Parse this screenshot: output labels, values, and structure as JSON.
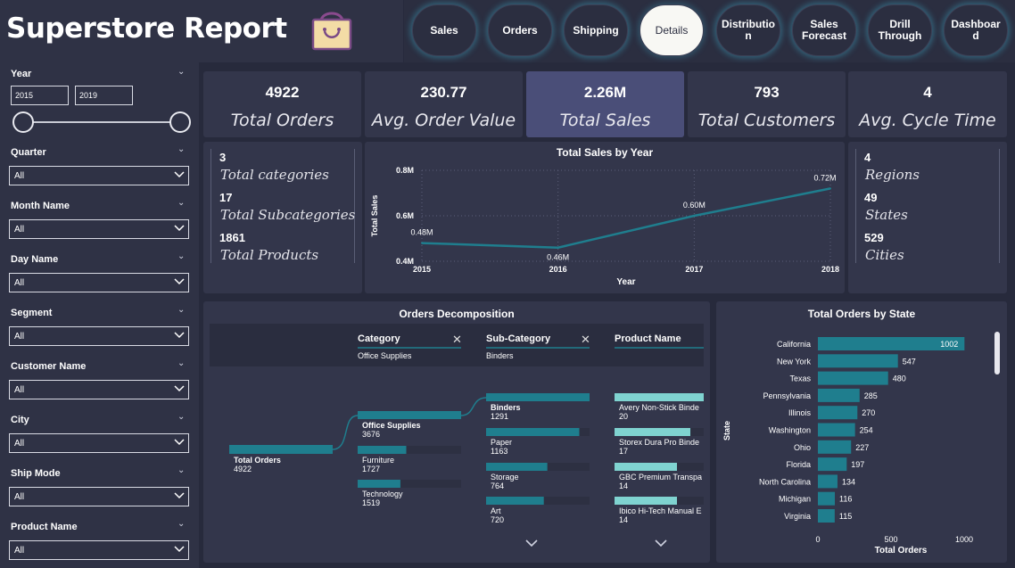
{
  "header": {
    "title": "Superstore Report",
    "logo_icon": "shopping-bag-icon"
  },
  "nav": {
    "buttons": [
      {
        "label": "Sales",
        "active": false
      },
      {
        "label": "Orders",
        "active": false
      },
      {
        "label": "Shipping",
        "active": false
      },
      {
        "label": "Details",
        "active": true
      },
      {
        "label": "Distributio n",
        "active": false
      },
      {
        "label": "Sales Forecast",
        "active": false
      },
      {
        "label": "Drill Through",
        "active": false
      },
      {
        "label": "Dashboar d",
        "active": false
      }
    ]
  },
  "filters": {
    "year": {
      "label": "Year",
      "from": "2015",
      "to": "2019"
    },
    "slicers": [
      {
        "label": "Quarter",
        "value": "All"
      },
      {
        "label": "Month Name",
        "value": "All"
      },
      {
        "label": "Day Name",
        "value": "All"
      },
      {
        "label": "Segment",
        "value": "All"
      },
      {
        "label": "Customer Name",
        "value": "All"
      },
      {
        "label": "City",
        "value": "All"
      },
      {
        "label": "Ship Mode",
        "value": "All"
      },
      {
        "label": "Product Name",
        "value": "All"
      }
    ]
  },
  "kpis": [
    {
      "value": "4922",
      "label": "Total Orders"
    },
    {
      "value": "230.77",
      "label": "Avg. Order Value"
    },
    {
      "value": "2.26M",
      "label": "Total Sales"
    },
    {
      "value": "793",
      "label": "Total Customers"
    },
    {
      "value": "4",
      "label": "Avg. Cycle Time"
    }
  ],
  "product_info": [
    {
      "value": "3",
      "label": "Total categories"
    },
    {
      "value": "17",
      "label": "Total Subcategories"
    },
    {
      "value": "1861",
      "label": "Total Products"
    }
  ],
  "geo_info": [
    {
      "value": "4",
      "label": "Regions"
    },
    {
      "value": "49",
      "label": "States"
    },
    {
      "value": "529",
      "label": "Cities"
    }
  ],
  "colors": {
    "accent": "#1f7e8e",
    "accent_light": "#7fd3d0",
    "highlight_card": "#4a4e78",
    "panel": "#33364b"
  },
  "chart_data": [
    {
      "type": "line",
      "title": "Total Sales by Year",
      "xlabel": "Year",
      "ylabel": "Total Sales",
      "x": [
        "2015",
        "2016",
        "2017",
        "2018"
      ],
      "values": [
        0.48,
        0.46,
        0.6,
        0.72
      ],
      "data_labels": [
        "0.48M",
        "0.46M",
        "0.60M",
        "0.72M"
      ],
      "y_ticks": [
        "0.4M",
        "0.6M",
        "0.8M"
      ],
      "ylim": [
        0.4,
        0.8
      ],
      "grid": true
    },
    {
      "type": "bar",
      "orientation": "horizontal",
      "title": "Total Orders by State",
      "xlabel": "Total Orders",
      "ylabel": "State",
      "categories": [
        "California",
        "New York",
        "Texas",
        "Pennsylvania",
        "Illinois",
        "Washington",
        "Ohio",
        "Florida",
        "North Carolina",
        "Michigan",
        "Virginia"
      ],
      "values": [
        1002,
        547,
        480,
        285,
        270,
        254,
        227,
        197,
        134,
        116,
        115
      ],
      "x_ticks": [
        "0",
        "500",
        "1000"
      ],
      "xlim": [
        0,
        1000
      ]
    }
  ],
  "decomposition": {
    "title": "Orders Decomposition",
    "levels": [
      {
        "header": "Category",
        "filter": "Office Supplies"
      },
      {
        "header": "Sub-Category",
        "filter": "Binders"
      },
      {
        "header": "Product Name",
        "filter": ""
      }
    ],
    "root": {
      "label": "Total Orders",
      "value": 4922
    },
    "category": [
      {
        "label": "Office Supplies",
        "value": 3676,
        "selected": true
      },
      {
        "label": "Furniture",
        "value": 1727
      },
      {
        "label": "Technology",
        "value": 1519
      }
    ],
    "subcategory": [
      {
        "label": "Binders",
        "value": 1291,
        "selected": true
      },
      {
        "label": "Paper",
        "value": 1163
      },
      {
        "label": "Storage",
        "value": 764
      },
      {
        "label": "Art",
        "value": 720
      }
    ],
    "products": [
      {
        "label": "Avery Non-Stick Binde",
        "value": 20
      },
      {
        "label": "Storex Dura Pro Binde",
        "value": 17
      },
      {
        "label": "GBC Premium Transpa",
        "value": 14
      },
      {
        "label": "Ibico Hi-Tech Manual E",
        "value": 14
      }
    ]
  }
}
